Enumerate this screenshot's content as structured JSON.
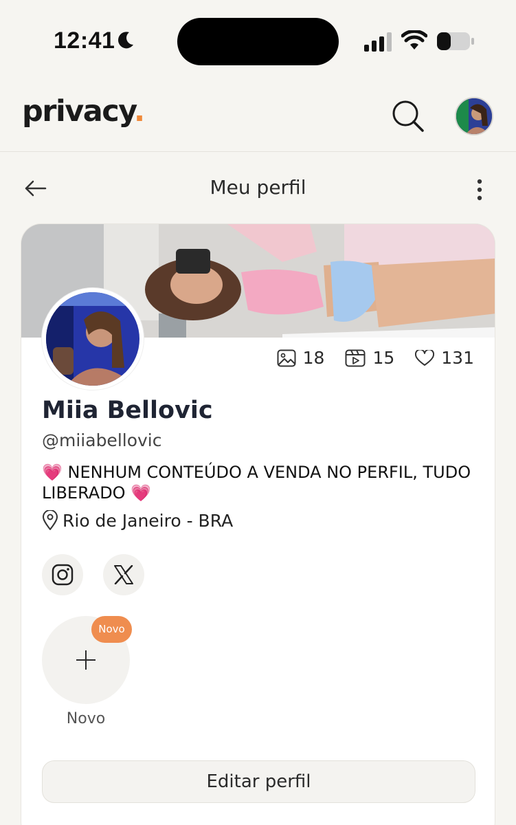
{
  "status_bar": {
    "time": "12:41"
  },
  "header": {
    "logo_text": "privacy",
    "logo_dot": "."
  },
  "subnav": {
    "title": "Meu perfil"
  },
  "profile": {
    "name": "Miia Bellovic",
    "handle": "@miiabellovic",
    "bio": "💗 NENHUM CONTEÚDO A VENDA NO PERFIL, TUDO LIBERADO 💗",
    "location": "Rio de Janeiro - BRA",
    "stats": {
      "photos": "18",
      "videos": "15",
      "likes": "131"
    }
  },
  "stories": {
    "badge": "Novo",
    "label": "Novo"
  },
  "actions": {
    "edit_label": "Editar perfil"
  },
  "colors": {
    "accent": "#f08a3b",
    "badge": "#ef8d4f",
    "background": "#f6f5f1"
  }
}
